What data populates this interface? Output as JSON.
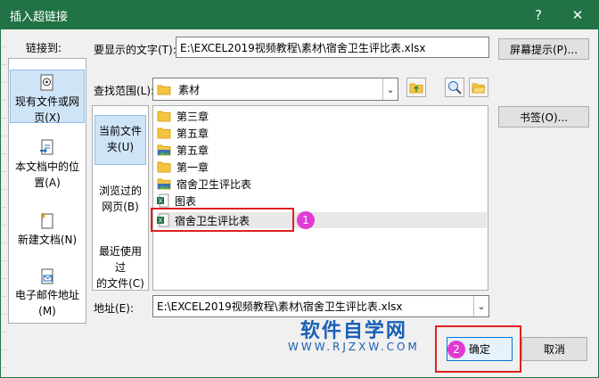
{
  "window": {
    "title": "插入超链接",
    "help": "?",
    "close": "✕"
  },
  "link_to": {
    "label": "链接到:",
    "items": [
      {
        "label_line1": "现有文件或网",
        "label_line2": "页(X)"
      },
      {
        "label_line1": "本文档中的位",
        "label_line2": "置(A)"
      },
      {
        "label_line1": "新建文档(N)",
        "label_line2": ""
      },
      {
        "label_line1": "电子邮件地址",
        "label_line2": "(M)"
      }
    ]
  },
  "display_text": {
    "label": "要显示的文字(T):",
    "value": "E:\\EXCEL2019视频教程\\素材\\宿舍卫生评比表.xlsx"
  },
  "screen_tip_button": "屏幕提示(P)...",
  "look_in": {
    "label": "查找范围(L):",
    "value": "素材"
  },
  "bookmark_button": "书签(O)...",
  "subnav": [
    {
      "line1": "当前文件",
      "line2": "夹(U)"
    },
    {
      "line1": "浏览过的",
      "line2": "网页(B)"
    },
    {
      "line1": "最近使用过",
      "line2": "的文件(C)"
    }
  ],
  "files": [
    {
      "name": "第三章",
      "icon": "folder-icon"
    },
    {
      "name": "第五章",
      "icon": "folder-icon"
    },
    {
      "name": "第五章",
      "icon": "folder-image-icon"
    },
    {
      "name": "第一章",
      "icon": "folder-icon"
    },
    {
      "name": "宿舍卫生评比表",
      "icon": "folder-image-icon"
    },
    {
      "name": "图表",
      "icon": "excel-file-icon"
    },
    {
      "name": "宿舍卫生评比表",
      "icon": "excel-file-icon"
    }
  ],
  "address": {
    "label": "地址(E):",
    "value": "E:\\EXCEL2019视频教程\\素材\\宿舍卫生评比表.xlsx"
  },
  "ok_button": "确定",
  "cancel_button": "取消",
  "badges": [
    "1",
    "2"
  ],
  "watermark": {
    "title": "软件自学网",
    "url": "WWW.RJZXW.COM"
  },
  "colors": {
    "title_bar": "#217346",
    "selection": "#cfe4f7",
    "annotation_red": "#e02020",
    "badge": "#e03bd2"
  }
}
